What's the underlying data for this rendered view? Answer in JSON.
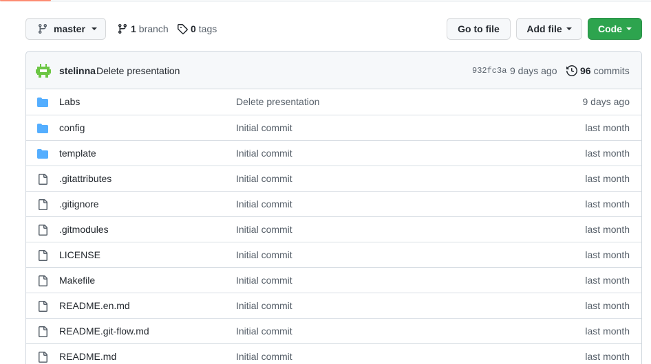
{
  "toolbar": {
    "branch_label": "master",
    "branches_count": "1",
    "branches_label": "branch",
    "tags_count": "0",
    "tags_label": "tags",
    "go_to_file": "Go to file",
    "add_file": "Add file",
    "code": "Code"
  },
  "latest_commit": {
    "author": "stelinna",
    "message": "Delete presentation",
    "sha": "932fc3a",
    "age": "9 days ago",
    "commits_count": "96",
    "commits_label": "commits"
  },
  "files": [
    {
      "type": "folder",
      "name": "Labs",
      "message": "Delete presentation",
      "age": "9 days ago"
    },
    {
      "type": "folder",
      "name": "config",
      "message": "Initial commit",
      "age": "last month"
    },
    {
      "type": "folder",
      "name": "template",
      "message": "Initial commit",
      "age": "last month"
    },
    {
      "type": "file",
      "name": ".gitattributes",
      "message": "Initial commit",
      "age": "last month"
    },
    {
      "type": "file",
      "name": ".gitignore",
      "message": "Initial commit",
      "age": "last month"
    },
    {
      "type": "file",
      "name": ".gitmodules",
      "message": "Initial commit",
      "age": "last month"
    },
    {
      "type": "file",
      "name": "LICENSE",
      "message": "Initial commit",
      "age": "last month"
    },
    {
      "type": "file",
      "name": "Makefile",
      "message": "Initial commit",
      "age": "last month"
    },
    {
      "type": "file",
      "name": "README.en.md",
      "message": "Initial commit",
      "age": "last month"
    },
    {
      "type": "file",
      "name": "README.git-flow.md",
      "message": "Initial commit",
      "age": "last month"
    },
    {
      "type": "file",
      "name": "README.md",
      "message": "Initial commit",
      "age": "last month"
    }
  ],
  "colors": {
    "accent_green": "#2da44e",
    "folder_blue": "#54aeff",
    "tab_underline": "#fd8c73",
    "avatar_green": "#6cc644"
  }
}
